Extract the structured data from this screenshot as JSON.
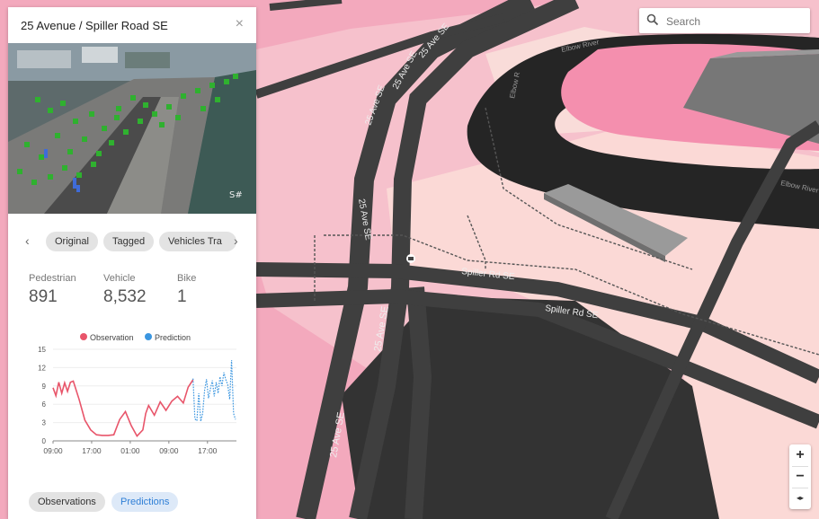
{
  "panel": {
    "title": "25 Avenue / Spiller Road SE",
    "close_glyph": "×",
    "camera_overlay_text": "S#",
    "tabs": [
      "Original",
      "Tagged",
      "Vehicles Tra"
    ],
    "stats": [
      {
        "label": "Pedestrian",
        "value": "891"
      },
      {
        "label": "Vehicle",
        "value": "8,532"
      },
      {
        "label": "Bike",
        "value": "1"
      }
    ],
    "buttons": {
      "observations": "Observations",
      "predictions": "Predictions"
    }
  },
  "search": {
    "placeholder": "Search"
  },
  "map": {
    "labels": {
      "elbow_river_1": "Elbow River",
      "elbow_river_2": "Elbow River",
      "elbow_river_3": "Elbow R",
      "ave_25_1": "25 Ave SE",
      "ave_25_2": "25 Ave SE",
      "ave_25_3": "25 Ave SE",
      "ave_25_4": "25 Ave SE",
      "ave_25_5": "25 Ave SE",
      "ave_25_6": "25 Ave SE",
      "spiller_1": "Spiller Rd SE",
      "spiller_2": "Spiller Rd SE"
    },
    "zoom": {
      "in": "+",
      "out": "−",
      "compass": "◂▸"
    }
  },
  "colors": {
    "observation": "#e8556a",
    "prediction": "#3b96e0",
    "map_pink": "#f3a9bd",
    "road": "#404040"
  },
  "chart_data": {
    "type": "line",
    "legend": [
      "Observation",
      "Prediction"
    ],
    "legend_position": "top",
    "x_ticks": [
      "09:00",
      "17:00",
      "01:00",
      "09:00",
      "17:00"
    ],
    "x_tick_positions": [
      0,
      8,
      16,
      24,
      32
    ],
    "y_ticks": [
      "15",
      "12",
      "9",
      "6",
      "3",
      "0"
    ],
    "ylim": [
      0,
      15
    ],
    "xlim": [
      0,
      38
    ],
    "series": [
      {
        "name": "Observation",
        "style": "solid",
        "x": [
          0,
          0.6,
          1.2,
          1.8,
          2.4,
          3,
          3.6,
          4.2,
          5.4,
          6.6,
          7.8,
          9,
          10.2,
          11.4,
          12.6,
          13.8,
          15,
          16.2,
          17.4,
          18.6,
          19.2,
          19.8,
          21,
          22.2,
          23.4,
          24.6,
          25.8,
          27,
          28,
          29
        ],
        "y": [
          8.7,
          7.4,
          9.6,
          7.8,
          9.5,
          8.1,
          9.6,
          9.8,
          6.8,
          3.4,
          1.8,
          1.0,
          0.9,
          0.9,
          1.0,
          3.5,
          4.8,
          2.5,
          0.8,
          1.8,
          4.5,
          5.8,
          4.2,
          6.4,
          5.0,
          6.5,
          7.3,
          6.2,
          8.8,
          10.0
        ]
      },
      {
        "name": "Prediction",
        "style": "dotted",
        "x": [
          29,
          29.4,
          29.8,
          30.2,
          30.6,
          31,
          31.4,
          31.8,
          32.2,
          32.6,
          33,
          33.4,
          33.8,
          34.2,
          34.6,
          35,
          35.4,
          35.8,
          36.2,
          36.6,
          37,
          37.4,
          37.8
        ],
        "y": [
          10.2,
          3.6,
          3.3,
          7.8,
          3.2,
          4.5,
          8.3,
          10.1,
          7.0,
          8.5,
          9.9,
          7.3,
          9.6,
          7.8,
          10.5,
          9.0,
          11.2,
          10.0,
          9.2,
          6.8,
          13.2,
          4.5,
          3.5
        ]
      }
    ]
  }
}
